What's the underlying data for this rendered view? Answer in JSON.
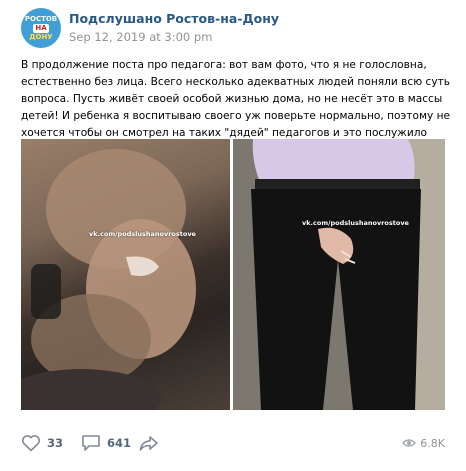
{
  "header": {
    "page_name": "Подслушано Ростов-на-Дону",
    "date": "Sep 12, 2019 at 3:00 pm",
    "avatar_text": [
      "РОСТОВ",
      "НА",
      "ДОНУ"
    ]
  },
  "post": {
    "text": "В продолжение поста про педагога: вот вам фото, что я не голословна, естественно без лица. Всего несколько адекватных людей поняли всю суть вопроса. Пусть живёт своей особой жизнью дома, но не несёт это в массы детей! И ребенка я воспитываю своего уж поверьте нормально, поэтому не хочется чтобы он смотрел на таких \"дядей\" педагогов и это послужило примером для подражания!"
  },
  "photos": {
    "watermark_left": "vk.com/podslushanovrostove",
    "watermark_right": "vk.com/podslushanovrostove"
  },
  "actions": {
    "likes": "33",
    "comments": "641",
    "views": "6.8K"
  },
  "icons": {
    "like": "heart-icon",
    "comment": "comment-bubble-icon",
    "share": "share-arrow-icon",
    "views": "eye-icon"
  },
  "colors": {
    "link": "#2a5885",
    "muted": "#939393",
    "action": "#55677d",
    "avatar_bg": "#3f9fd6"
  }
}
